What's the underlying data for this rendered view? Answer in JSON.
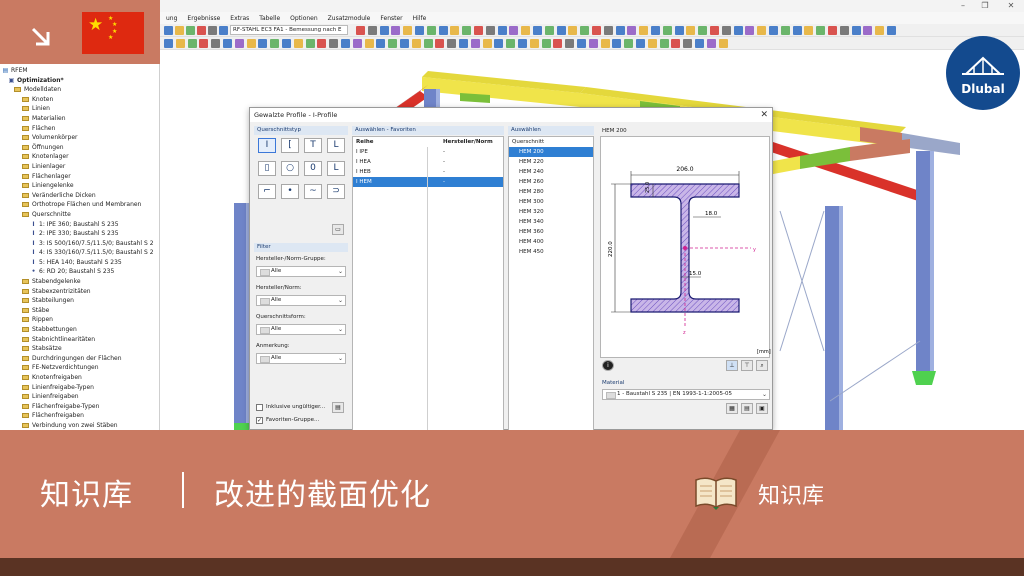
{
  "window": {
    "menu": [
      "ung",
      "Ergebnisse",
      "Extras",
      "Tabelle",
      "Optionen",
      "Zusatzmodule",
      "Fenster",
      "Hilfe"
    ],
    "module_dropdown": "RF-STAHL EC3 FA1 - Bemessung nach E",
    "controls": {
      "minimize": "–",
      "restore": "❐",
      "close": "✕"
    }
  },
  "sidebar": {
    "header": "RFEM",
    "project": "Optimization*",
    "items": [
      {
        "level": 1,
        "kind": "folder",
        "label": "Modelldaten"
      },
      {
        "level": 2,
        "kind": "folder",
        "label": "Knoten"
      },
      {
        "level": 2,
        "kind": "folder",
        "label": "Linien"
      },
      {
        "level": 2,
        "kind": "folder",
        "label": "Materialien"
      },
      {
        "level": 2,
        "kind": "folder",
        "label": "Flächen"
      },
      {
        "level": 2,
        "kind": "folder",
        "label": "Volumenkörper"
      },
      {
        "level": 2,
        "kind": "folder",
        "label": "Öffnungen"
      },
      {
        "level": 2,
        "kind": "folder",
        "label": "Knotenlager"
      },
      {
        "level": 2,
        "kind": "folder",
        "label": "Linienlager"
      },
      {
        "level": 2,
        "kind": "folder",
        "label": "Flächenlager"
      },
      {
        "level": 2,
        "kind": "folder",
        "label": "Liniengelenke"
      },
      {
        "level": 2,
        "kind": "folder",
        "label": "Veränderliche Dicken"
      },
      {
        "level": 2,
        "kind": "folder",
        "label": "Orthotrope Flächen und Membranen"
      },
      {
        "level": 2,
        "kind": "folder",
        "label": "Querschnitte"
      },
      {
        "level": 3,
        "kind": "section",
        "icon": "I",
        "label": "1: IPE 360; Baustahl S 235"
      },
      {
        "level": 3,
        "kind": "section",
        "icon": "I",
        "label": "2: IPE 330; Baustahl S 235"
      },
      {
        "level": 3,
        "kind": "section",
        "icon": "I",
        "label": "3: IS 500/160/7.5/11.5/0; Baustahl S 2"
      },
      {
        "level": 3,
        "kind": "section",
        "icon": "I",
        "label": "4: IS 330/160/7.5/11.5/0; Baustahl S 2"
      },
      {
        "level": 3,
        "kind": "section",
        "icon": "I",
        "label": "5: HEA 140; Baustahl S 235"
      },
      {
        "level": 3,
        "kind": "section",
        "icon": "•",
        "label": "6: RD 20; Baustahl S 235"
      },
      {
        "level": 2,
        "kind": "folder",
        "label": "Stabendgelenke"
      },
      {
        "level": 2,
        "kind": "folder",
        "label": "Stabexzentrizitäten"
      },
      {
        "level": 2,
        "kind": "folder",
        "label": "Stabteilungen"
      },
      {
        "level": 2,
        "kind": "folder",
        "label": "Stäbe"
      },
      {
        "level": 2,
        "kind": "folder",
        "label": "Rippen"
      },
      {
        "level": 2,
        "kind": "folder",
        "label": "Stabbettungen"
      },
      {
        "level": 2,
        "kind": "folder",
        "label": "Stabnichtlinearitäten"
      },
      {
        "level": 2,
        "kind": "folder",
        "label": "Stabsätze"
      },
      {
        "level": 2,
        "kind": "folder",
        "label": "Durchdringungen der Flächen"
      },
      {
        "level": 2,
        "kind": "folder",
        "label": "FE-Netzverdichtungen"
      },
      {
        "level": 2,
        "kind": "folder",
        "label": "Knotenfreigaben"
      },
      {
        "level": 2,
        "kind": "folder",
        "label": "Linienfreigabe-Typen"
      },
      {
        "level": 2,
        "kind": "folder",
        "label": "Linienfreigaben"
      },
      {
        "level": 2,
        "kind": "folder",
        "label": "Flächenfreigabe-Typen"
      },
      {
        "level": 2,
        "kind": "folder",
        "label": "Flächenfreigaben"
      },
      {
        "level": 2,
        "kind": "folder",
        "label": "Verbindung von zwei Stäben"
      }
    ]
  },
  "dialog": {
    "title": "Gewalzte Profile - I-Profile",
    "close": "✕",
    "section_type_header": "Querschnittstyp",
    "section_types": [
      "I",
      "[",
      "T",
      "L",
      "▯",
      "○",
      "0",
      "L",
      "⌐",
      "•",
      "~",
      "⊃"
    ],
    "filter": {
      "header": "Filter",
      "group_label": "Hersteller-/Norm-Gruppe:",
      "group_value": "Alle",
      "manufacturer_label": "Hersteller/Norm:",
      "manufacturer_value": "Alle",
      "shape_label": "Querschnittsform:",
      "shape_value": "Alle",
      "note_label": "Anmerkung:",
      "note_value": "Alle",
      "include_invalid": "Inklusive ungültiger...",
      "favorites_group": "Favoriten-Gruppe..."
    },
    "favorites": {
      "header": "Auswählen - Favoriten",
      "col_series": "Reihe",
      "col_manufacturer": "Hersteller/Norm",
      "rows": [
        {
          "series": "IPE",
          "maker": "-"
        },
        {
          "series": "HEA",
          "maker": "-"
        },
        {
          "series": "HEB",
          "maker": "-"
        },
        {
          "series": "HEM",
          "maker": "-"
        }
      ],
      "selected_index": 3
    },
    "select": {
      "header": "Auswählen",
      "col": "Querschnitt",
      "items": [
        "HEM 200",
        "HEM 220",
        "HEM 240",
        "HEM 260",
        "HEM 280",
        "HEM 300",
        "HEM 320",
        "HEM 340",
        "HEM 360",
        "HEM 400",
        "HEM 450"
      ],
      "selected_index": 0
    },
    "preview": {
      "name": "HEM 200",
      "dim_width": "206.0",
      "dim_flange": "25.0",
      "dim_radius": "18.0",
      "dim_height": "220.0",
      "dim_web": "15.0",
      "axis_y": "y",
      "axis_z": "z",
      "unit": "[mm]"
    },
    "material": {
      "label": "Material",
      "value": "1 - Baustahl S 235 | EN 1993-1-1:2005-05"
    }
  },
  "branding": {
    "company": "Dlubal"
  },
  "banner": {
    "title": "知识库",
    "separator": "|",
    "subtitle": "改进的截面优化",
    "badge": "知识库",
    "color_main": "#c97a62",
    "color_dark": "#5a3323"
  }
}
